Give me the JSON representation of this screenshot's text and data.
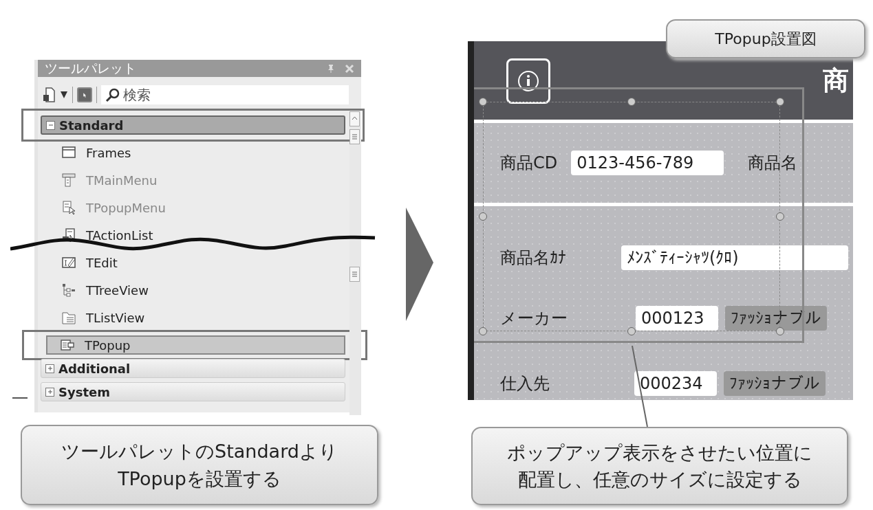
{
  "palette": {
    "title": "ツールパレット",
    "search": {
      "placeholder": "検索"
    },
    "groups": [
      {
        "label": "Standard",
        "expanded": true,
        "highlighted": true,
        "items": [
          {
            "label": "Frames",
            "kind": "frame",
            "disabled": false,
            "highlighted": false
          },
          {
            "label": "TMainMenu",
            "kind": "main-menu",
            "disabled": true,
            "highlighted": false
          },
          {
            "label": "TPopupMenu",
            "kind": "popup-menu",
            "disabled": true,
            "highlighted": false
          },
          {
            "label": "TActionList",
            "kind": "action-list",
            "disabled": false,
            "highlighted": false
          },
          {
            "label": "TEdit",
            "kind": "edit",
            "disabled": false,
            "highlighted": false
          },
          {
            "label": "TTreeView",
            "kind": "tree-view",
            "disabled": false,
            "highlighted": false
          },
          {
            "label": "TListView",
            "kind": "list-view",
            "disabled": false,
            "highlighted": false
          },
          {
            "label": "TPopup",
            "kind": "popup",
            "disabled": false,
            "highlighted": true
          }
        ]
      },
      {
        "label": "Additional",
        "expanded": false,
        "highlighted": false
      },
      {
        "label": "System",
        "expanded": false,
        "highlighted": false
      }
    ]
  },
  "palette_note": [
    "ツールパレットのStandardより",
    "TPopupを設置する"
  ],
  "form_tag": "TPopup設置図",
  "form": {
    "title": "商",
    "rows": [
      {
        "fields": [
          {
            "kind": "label",
            "text": "商品CD"
          },
          {
            "kind": "input",
            "text": "0123-456-789"
          },
          {
            "kind": "label",
            "text": "商品名"
          }
        ]
      },
      {
        "fields": [
          {
            "kind": "label",
            "text": "商品名ｶﾅ"
          },
          {
            "kind": "input",
            "text": "ﾒﾝｽﾞﾃｨｰｼｬﾂ(ｸﾛ)"
          }
        ]
      },
      {
        "fields": [
          {
            "kind": "label",
            "text": "メーカー"
          },
          {
            "kind": "input",
            "text": "000123"
          },
          {
            "kind": "display",
            "text": "ﾌｧｯｼｮナブル"
          }
        ]
      },
      {
        "fields": [
          {
            "kind": "label",
            "text": "仕入先"
          },
          {
            "kind": "input",
            "text": "000234"
          },
          {
            "kind": "display",
            "text": "ﾌｧｯｼｮナブル"
          }
        ]
      }
    ]
  },
  "form_note": [
    "ポップアップ表示をさせたい位置に",
    "配置し、任意のサイズに設定する"
  ]
}
